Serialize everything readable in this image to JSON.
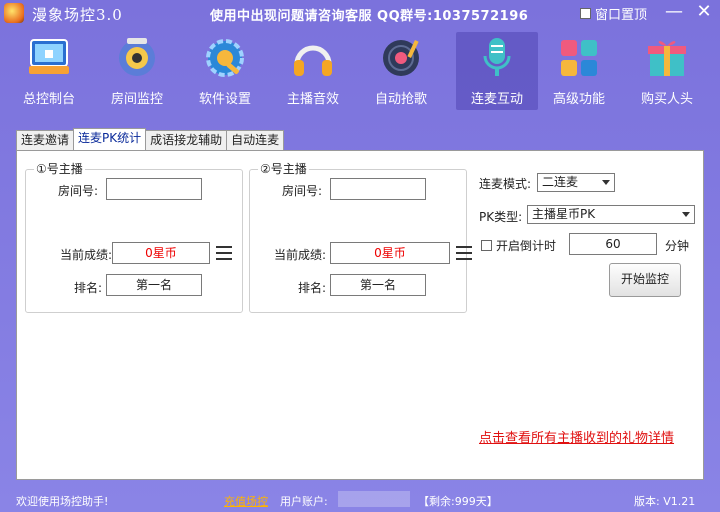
{
  "window": {
    "title": "漫象场控3.0",
    "notice": "使用中出现问题请咨询客服 QQ群号:1037572196",
    "topmost_label": "窗口置顶",
    "minimize": "—",
    "close": "✕"
  },
  "toolbar": {
    "items": [
      {
        "label": "总控制台",
        "icon": "dashboard-icon"
      },
      {
        "label": "房间监控",
        "icon": "camera-icon"
      },
      {
        "label": "软件设置",
        "icon": "gear-icon"
      },
      {
        "label": "主播音效",
        "icon": "headphones-icon"
      },
      {
        "label": "自动抢歌",
        "icon": "vinyl-icon"
      },
      {
        "label": "连麦互动",
        "icon": "microphone-icon"
      },
      {
        "label": "高级功能",
        "icon": "blocks-icon"
      },
      {
        "label": "购买人头",
        "icon": "gift-icon"
      }
    ],
    "active_index": 5
  },
  "tabs": [
    {
      "label": "连麦邀请"
    },
    {
      "label": "连麦PK统计"
    },
    {
      "label": "成语接龙辅助"
    },
    {
      "label": "自动连麦"
    }
  ],
  "anchor1": {
    "group_title": "①号主播",
    "room_label": "房间号:",
    "room_value": "",
    "score_label": "当前成绩:",
    "score_value": "0星币",
    "rank_label": "排名:",
    "rank_value": "第一名"
  },
  "anchor2": {
    "group_title": "②号主播",
    "room_label": "房间号:",
    "room_value": "",
    "score_label": "当前成绩:",
    "score_value": "0星币",
    "rank_label": "排名:",
    "rank_value": "第一名"
  },
  "settings": {
    "mode_label": "连麦模式:",
    "mode_value": "二连麦",
    "pk_label": "PK类型:",
    "pk_value": "主播星币PK",
    "countdown_label": "开启倒计时",
    "countdown_value": "60",
    "minutes_label": "分钟",
    "start_button": "开始监控",
    "detail_link": "点击查看所有主播收到的礼物详情"
  },
  "status": {
    "welcome": "欢迎使用场控助手!",
    "recharge": "充值场控",
    "account_label": "用户账户:",
    "remaining": "【剩余:999天】",
    "version": "版本: V1.21"
  }
}
